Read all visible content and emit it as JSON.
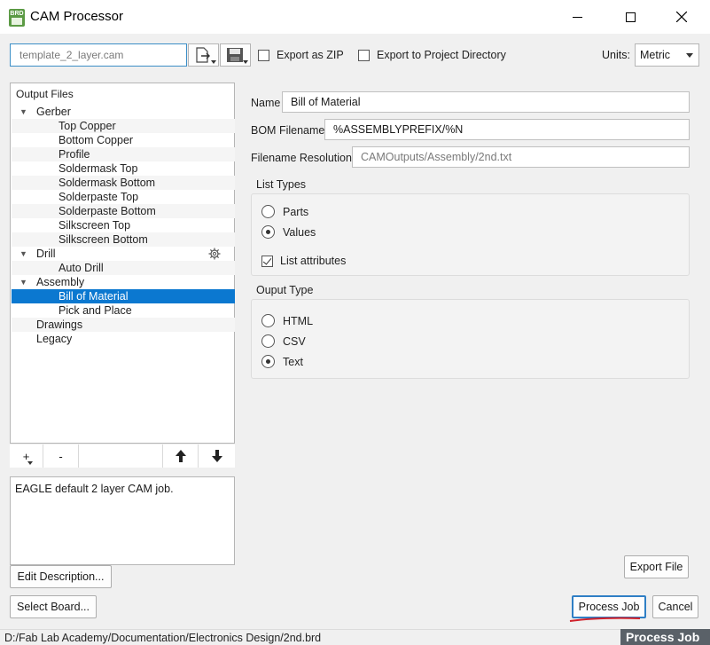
{
  "window": {
    "title": "CAM Processor",
    "icon_text": "BRD"
  },
  "toolbar": {
    "template_value": "template_2_layer.cam",
    "open_icon": "open-file-icon",
    "save_icon": "save-floppy-icon",
    "export_zip_label": "Export as ZIP",
    "export_zip_checked": false,
    "export_project_dir_label": "Export to Project Directory",
    "export_project_dir_checked": false,
    "units_label": "Units:",
    "units_value": "Metric"
  },
  "tree": {
    "header": "Output Files",
    "rows": [
      {
        "label": "Gerber",
        "level": 0,
        "expanded": true
      },
      {
        "label": "Top Copper",
        "level": 1
      },
      {
        "label": "Bottom Copper",
        "level": 1
      },
      {
        "label": "Profile",
        "level": 1
      },
      {
        "label": "Soldermask Top",
        "level": 1
      },
      {
        "label": "Soldermask Bottom",
        "level": 1
      },
      {
        "label": "Solderpaste Top",
        "level": 1
      },
      {
        "label": "Solderpaste Bottom",
        "level": 1
      },
      {
        "label": "Silkscreen Top",
        "level": 1
      },
      {
        "label": "Silkscreen Bottom",
        "level": 1
      },
      {
        "label": "Drill",
        "level": 0,
        "expanded": true,
        "gear": true
      },
      {
        "label": "Auto Drill",
        "level": 1
      },
      {
        "label": "Assembly",
        "level": 0,
        "expanded": true
      },
      {
        "label": "Bill of Material",
        "level": 1,
        "selected": true
      },
      {
        "label": "Pick and Place",
        "level": 1
      },
      {
        "label": "Drawings",
        "level": 0
      },
      {
        "label": "Legacy",
        "level": 0
      }
    ],
    "add_label": "+",
    "remove_label": "-"
  },
  "description": {
    "text": "EAGLE default 2 layer CAM job.",
    "edit_button": "Edit Description..."
  },
  "select_board_button": "Select Board...",
  "details": {
    "name_label": "Name",
    "name_value": "Bill of Material",
    "bom_label": "BOM Filename",
    "bom_value": "%ASSEMBLYPREFIX/%N",
    "resolution_label": "Filename Resolution",
    "resolution_value": "CAMOutputs/Assembly/2nd.txt",
    "list_types": {
      "title": "List Types",
      "options": [
        "Parts",
        "Values"
      ],
      "selected": "Values",
      "list_attributes_label": "List attributes",
      "list_attributes_checked": true
    },
    "output_type": {
      "title": "Ouput Type",
      "options": [
        "HTML",
        "CSV",
        "Text"
      ],
      "selected": "Text"
    }
  },
  "buttons": {
    "export_file": "Export File",
    "process_job": "Process Job",
    "cancel": "Cancel"
  },
  "status": {
    "path": "D:/Fab Lab Academy/Documentation/Electronics Design/2nd.brd",
    "tooltip": "Process Job"
  },
  "colors": {
    "selection": "#0b78d0",
    "focus_border": "#2f7fc5",
    "annotation_red": "#d0202a",
    "tooltip_bg": "#5a6168"
  }
}
